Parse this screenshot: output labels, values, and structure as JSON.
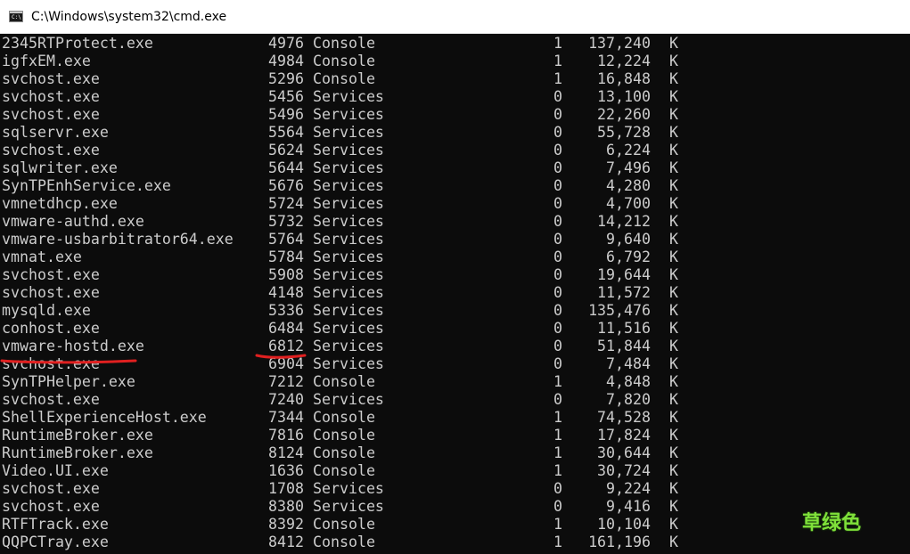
{
  "window": {
    "title": "C:\\Windows\\system32\\cmd.exe",
    "icon": "cmd-icon",
    "icon_glyph": "C:\\"
  },
  "processes": [
    {
      "name": "2345RTProtect.exe",
      "pid": "4976",
      "session_name": "Console",
      "session": "1",
      "mem": "137,240",
      "unit": "K"
    },
    {
      "name": "igfxEM.exe",
      "pid": "4984",
      "session_name": "Console",
      "session": "1",
      "mem": "12,224",
      "unit": "K"
    },
    {
      "name": "svchost.exe",
      "pid": "5296",
      "session_name": "Console",
      "session": "1",
      "mem": "16,848",
      "unit": "K"
    },
    {
      "name": "svchost.exe",
      "pid": "5456",
      "session_name": "Services",
      "session": "0",
      "mem": "13,100",
      "unit": "K"
    },
    {
      "name": "svchost.exe",
      "pid": "5496",
      "session_name": "Services",
      "session": "0",
      "mem": "22,260",
      "unit": "K"
    },
    {
      "name": "sqlservr.exe",
      "pid": "5564",
      "session_name": "Services",
      "session": "0",
      "mem": "55,728",
      "unit": "K"
    },
    {
      "name": "svchost.exe",
      "pid": "5624",
      "session_name": "Services",
      "session": "0",
      "mem": "6,224",
      "unit": "K"
    },
    {
      "name": "sqlwriter.exe",
      "pid": "5644",
      "session_name": "Services",
      "session": "0",
      "mem": "7,496",
      "unit": "K"
    },
    {
      "name": "SynTPEnhService.exe",
      "pid": "5676",
      "session_name": "Services",
      "session": "0",
      "mem": "4,280",
      "unit": "K"
    },
    {
      "name": "vmnetdhcp.exe",
      "pid": "5724",
      "session_name": "Services",
      "session": "0",
      "mem": "4,700",
      "unit": "K"
    },
    {
      "name": "vmware-authd.exe",
      "pid": "5732",
      "session_name": "Services",
      "session": "0",
      "mem": "14,212",
      "unit": "K"
    },
    {
      "name": "vmware-usbarbitrator64.exe",
      "pid": "5764",
      "session_name": "Services",
      "session": "0",
      "mem": "9,640",
      "unit": "K"
    },
    {
      "name": "vmnat.exe",
      "pid": "5784",
      "session_name": "Services",
      "session": "0",
      "mem": "6,792",
      "unit": "K"
    },
    {
      "name": "svchost.exe",
      "pid": "5908",
      "session_name": "Services",
      "session": "0",
      "mem": "19,644",
      "unit": "K"
    },
    {
      "name": "svchost.exe",
      "pid": "4148",
      "session_name": "Services",
      "session": "0",
      "mem": "11,572",
      "unit": "K"
    },
    {
      "name": "mysqld.exe",
      "pid": "5336",
      "session_name": "Services",
      "session": "0",
      "mem": "135,476",
      "unit": "K"
    },
    {
      "name": "conhost.exe",
      "pid": "6484",
      "session_name": "Services",
      "session": "0",
      "mem": "11,516",
      "unit": "K"
    },
    {
      "name": "vmware-hostd.exe",
      "pid": "6812",
      "session_name": "Services",
      "session": "0",
      "mem": "51,844",
      "unit": "K",
      "highlighted": true
    },
    {
      "name": "svchost.exe",
      "pid": "6904",
      "session_name": "Services",
      "session": "0",
      "mem": "7,484",
      "unit": "K"
    },
    {
      "name": "SynTPHelper.exe",
      "pid": "7212",
      "session_name": "Console",
      "session": "1",
      "mem": "4,848",
      "unit": "K"
    },
    {
      "name": "svchost.exe",
      "pid": "7240",
      "session_name": "Services",
      "session": "0",
      "mem": "7,820",
      "unit": "K"
    },
    {
      "name": "ShellExperienceHost.exe",
      "pid": "7344",
      "session_name": "Console",
      "session": "1",
      "mem": "74,528",
      "unit": "K"
    },
    {
      "name": "RuntimeBroker.exe",
      "pid": "7816",
      "session_name": "Console",
      "session": "1",
      "mem": "17,824",
      "unit": "K"
    },
    {
      "name": "RuntimeBroker.exe",
      "pid": "8124",
      "session_name": "Console",
      "session": "1",
      "mem": "30,644",
      "unit": "K"
    },
    {
      "name": "Video.UI.exe",
      "pid": "1636",
      "session_name": "Console",
      "session": "1",
      "mem": "30,724",
      "unit": "K"
    },
    {
      "name": "svchost.exe",
      "pid": "1708",
      "session_name": "Services",
      "session": "0",
      "mem": "9,224",
      "unit": "K"
    },
    {
      "name": "svchost.exe",
      "pid": "8380",
      "session_name": "Services",
      "session": "0",
      "mem": "9,416",
      "unit": "K"
    },
    {
      "name": "RTFTrack.exe",
      "pid": "8392",
      "session_name": "Console",
      "session": "1",
      "mem": "10,104",
      "unit": "K"
    },
    {
      "name": "QQPCTray.exe",
      "pid": "8412",
      "session_name": "Console",
      "session": "1",
      "mem": "161,196",
      "unit": "K"
    }
  ],
  "annotations": {
    "underline_color": "#e02020"
  },
  "watermark": {
    "text": "草绿色",
    "color": "#7fe03a"
  }
}
